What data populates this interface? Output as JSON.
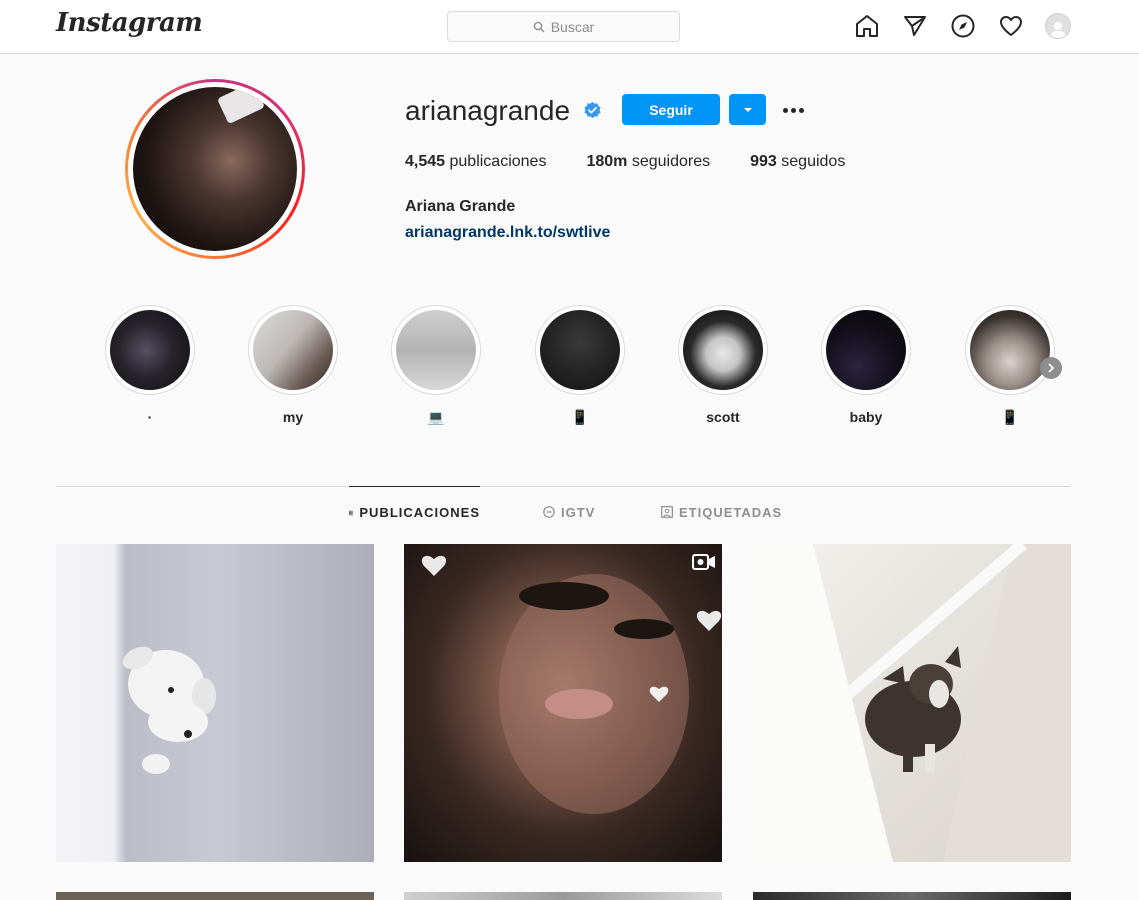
{
  "nav": {
    "logo": "Instagram",
    "search_placeholder": "Buscar",
    "icons": [
      "home-icon",
      "direct-icon",
      "explore-icon",
      "activity-icon",
      "avatar"
    ]
  },
  "profile": {
    "username": "arianagrande",
    "verified": true,
    "follow_label": "Seguir",
    "stats": {
      "posts_value": "4,545",
      "posts_label": "publicaciones",
      "followers_value": "180m",
      "followers_label": "seguidores",
      "following_value": "993",
      "following_label": "seguidos"
    },
    "full_name": "Ariana Grande",
    "link": "arianagrande.lnk.to/swtlive"
  },
  "highlights": [
    {
      "label": "·"
    },
    {
      "label": "my"
    },
    {
      "label": "💻"
    },
    {
      "label": "📱"
    },
    {
      "label": "scott"
    },
    {
      "label": "baby"
    },
    {
      "label": "📱"
    }
  ],
  "tabs": [
    {
      "label": "PUBLICACIONES",
      "active": true
    },
    {
      "label": "IGTV",
      "active": false
    },
    {
      "label": "ETIQUETADAS",
      "active": false
    }
  ],
  "colors": {
    "accent": "#0095f6",
    "link": "#00376b"
  }
}
